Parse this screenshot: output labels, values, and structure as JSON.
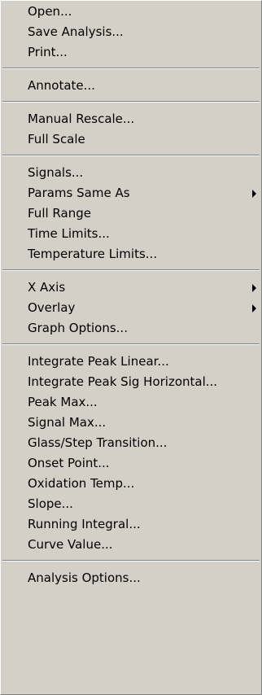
{
  "menu": {
    "groups": [
      [
        {
          "label": "Open...",
          "submenu": false
        },
        {
          "label": "Save Analysis...",
          "submenu": false
        },
        {
          "label": "Print...",
          "submenu": false
        }
      ],
      [
        {
          "label": "Annotate...",
          "submenu": false
        }
      ],
      [
        {
          "label": "Manual Rescale...",
          "submenu": false
        },
        {
          "label": "Full Scale",
          "submenu": false
        }
      ],
      [
        {
          "label": "Signals...",
          "submenu": false
        },
        {
          "label": "Params Same As",
          "submenu": true
        },
        {
          "label": "Full Range",
          "submenu": false
        },
        {
          "label": "Time Limits...",
          "submenu": false
        },
        {
          "label": "Temperature Limits...",
          "submenu": false
        }
      ],
      [
        {
          "label": "X Axis",
          "submenu": true
        },
        {
          "label": "Overlay",
          "submenu": true
        },
        {
          "label": "Graph Options...",
          "submenu": false
        }
      ],
      [
        {
          "label": "Integrate Peak Linear...",
          "submenu": false
        },
        {
          "label": "Integrate Peak Sig Horizontal...",
          "submenu": false
        },
        {
          "label": "Peak Max...",
          "submenu": false
        },
        {
          "label": "Signal Max...",
          "submenu": false
        },
        {
          "label": "Glass/Step Transition...",
          "submenu": false
        },
        {
          "label": "Onset Point...",
          "submenu": false
        },
        {
          "label": "Oxidation Temp...",
          "submenu": false
        },
        {
          "label": "Slope...",
          "submenu": false
        },
        {
          "label": "Running Integral...",
          "submenu": false
        },
        {
          "label": "Curve Value...",
          "submenu": false
        }
      ],
      [
        {
          "label": "Analysis Options...",
          "submenu": false
        }
      ]
    ]
  },
  "colors": {
    "menu_background": "#d4d0c8",
    "text": "#000000",
    "separator_shadow": "#808080",
    "separator_highlight": "#ffffff"
  }
}
